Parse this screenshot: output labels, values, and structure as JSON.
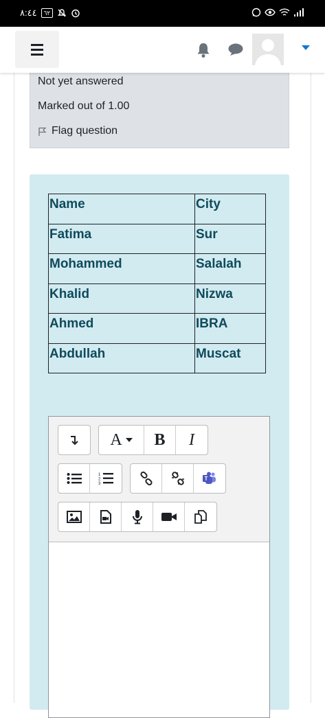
{
  "status_bar": {
    "time": "٨:٤٤",
    "battery": "٦٢"
  },
  "question_info": {
    "status": "Not yet answered",
    "marks": "Marked out of 1.00",
    "flag_label": "Flag question"
  },
  "table": {
    "rows": [
      [
        "Name",
        "City"
      ],
      [
        "Fatima",
        "Sur"
      ],
      [
        "Mohammed",
        "Salalah"
      ],
      [
        "Khalid",
        "Nizwa"
      ],
      [
        "Ahmed",
        "IBRA"
      ],
      [
        "Abdullah",
        "Muscat"
      ]
    ]
  },
  "toolbar": {
    "font_button_label": "A",
    "bold_label": "B",
    "italic_label": "I"
  },
  "colors": {
    "accent": "#1177d1",
    "content_bg": "#d2ebf0",
    "table_text": "#0f4a5c",
    "info_bg": "#dee2e6"
  }
}
